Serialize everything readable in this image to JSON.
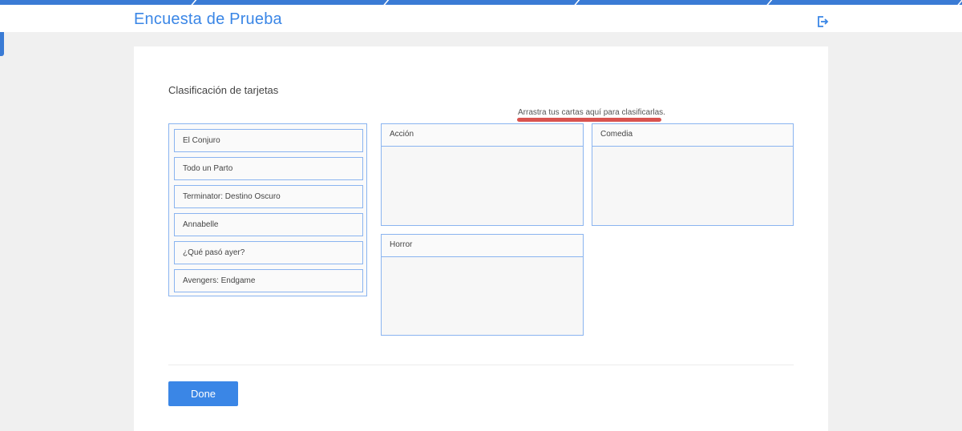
{
  "header": {
    "title": "Encuesta de Prueba",
    "logout_icon": "logout-icon"
  },
  "survey": {
    "section_title": "Clasificación de tarjetas",
    "instructions": "Arrastra tus cartas aquí para clasificarlas.",
    "cards": [
      "El Conjuro",
      "Todo un Parto",
      "Terminator: Destino Oscuro",
      "Annabelle",
      "¿Qué pasó ayer?",
      "Avengers: Endgame"
    ],
    "categories": [
      "Acción",
      "Comedia",
      "Horror"
    ],
    "done_label": "Done"
  },
  "colors": {
    "accent": "#3a86e6",
    "border": "#8ab4f0",
    "highlight": "#d9534f"
  }
}
